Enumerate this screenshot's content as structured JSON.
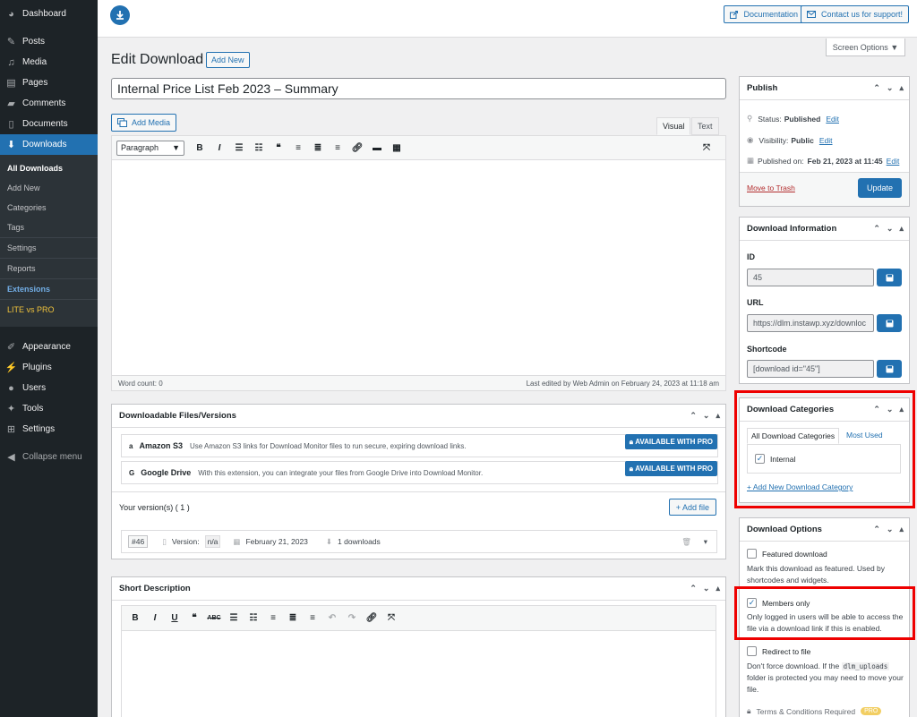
{
  "sidebar": {
    "items": [
      {
        "label": "Dashboard",
        "icon": "dashboard-icon"
      },
      {
        "label": "Posts",
        "icon": "pin-icon"
      },
      {
        "label": "Media",
        "icon": "media-icon"
      },
      {
        "label": "Pages",
        "icon": "pages-icon"
      },
      {
        "label": "Comments",
        "icon": "comment-icon"
      },
      {
        "label": "Documents",
        "icon": "document-icon"
      },
      {
        "label": "Downloads",
        "icon": "download-icon"
      }
    ],
    "submenu": [
      "All Downloads",
      "Add New",
      "Categories",
      "Tags",
      "Settings",
      "Reports",
      "Extensions",
      "LITE vs PRO"
    ],
    "lower": [
      {
        "label": "Appearance",
        "icon": "brush-icon"
      },
      {
        "label": "Plugins",
        "icon": "plugin-icon"
      },
      {
        "label": "Users",
        "icon": "user-icon"
      },
      {
        "label": "Tools",
        "icon": "wrench-icon"
      },
      {
        "label": "Settings",
        "icon": "settings-icon"
      },
      {
        "label": "Collapse menu",
        "icon": "collapse-icon"
      }
    ]
  },
  "topbar": {
    "documentation": "Documentation",
    "support": "Contact us for support!",
    "screen_options": "Screen Options"
  },
  "page": {
    "title": "Edit Download",
    "add_new": "Add New",
    "post_title": "Internal Price List Feb 2023 – Summary"
  },
  "editor": {
    "add_media": "Add Media",
    "tab_visual": "Visual",
    "tab_text": "Text",
    "format": "Paragraph",
    "word_count": "Word count: 0",
    "last_edited": "Last edited by Web Admin on February 24, 2023 at 11:18 am"
  },
  "files": {
    "title": "Downloadable Files/Versions",
    "extensions": [
      {
        "name": "Amazon S3",
        "desc": "Use Amazon S3 links for Download Monitor files to run secure, expiring download links.",
        "btn": "AVAILABLE WITH PRO"
      },
      {
        "name": "Google Drive",
        "desc": "With this extension, you can integrate your files from Google Drive into Download Monitor.",
        "btn": "AVAILABLE WITH PRO"
      }
    ],
    "versions_label": "Your version(s) ( 1 )",
    "add_file": "+ Add file",
    "version": {
      "id": "#46",
      "version_label": "Version:",
      "version_value": "n/a",
      "date": "February 21, 2023",
      "downloads": "1 downloads"
    }
  },
  "short_desc": {
    "title": "Short Description"
  },
  "publish": {
    "title": "Publish",
    "status_label": "Status:",
    "status_value": "Published",
    "visibility_label": "Visibility:",
    "visibility_value": "Public",
    "published_label": "Published on:",
    "published_value": "Feb 21, 2023 at 11:45",
    "edit": "Edit",
    "trash": "Move to Trash",
    "update": "Update"
  },
  "info": {
    "title": "Download Information",
    "id_label": "ID",
    "id_value": "45",
    "url_label": "URL",
    "url_value": "https://dlm.instawp.xyz/downloc",
    "shortcode_label": "Shortcode",
    "shortcode_value": "[download id=\"45\"]"
  },
  "categories": {
    "title": "Download Categories",
    "tab_all": "All Download Categories",
    "tab_most": "Most Used",
    "item": "Internal",
    "add": "+ Add New Download Category"
  },
  "options": {
    "title": "Download Options",
    "featured": "Featured download",
    "featured_desc": "Mark this download as featured. Used by shortcodes and widgets.",
    "members": "Members only",
    "members_desc": "Only logged in users will be able to access the file via a download link if this is enabled.",
    "redirect": "Redirect to file",
    "redirect_desc_a": "Don't force download. If the",
    "redirect_code": "dlm_uploads",
    "redirect_desc_b": "folder is protected you may need to move your file.",
    "terms": "Terms & Conditions Required",
    "pro": "PRO"
  },
  "colors": {
    "accent": "#2271b1",
    "sidebar": "#1d2327",
    "highlight": "#e00000"
  }
}
